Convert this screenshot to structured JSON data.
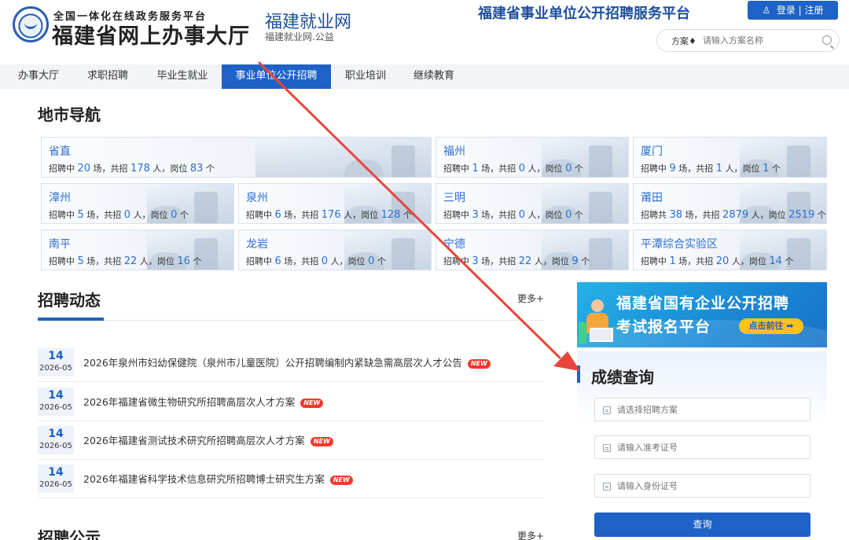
{
  "header": {
    "logo_line1": "全国一体化在线政务服务平台",
    "logo_line2": "福建省网上办事大厅",
    "site_name": "福建就业网",
    "site_sub": "福建就业网.公益",
    "platform_title": "福建省事业单位公开招聘服务平台",
    "login_label": "登录 | 注册",
    "search_type": "方案",
    "search_placeholder": "请输入方案名称"
  },
  "nav": {
    "items": [
      {
        "label": "办事大厅"
      },
      {
        "label": "求职招聘"
      },
      {
        "label": "毕业生就业"
      },
      {
        "label": "事业单位公开招聘",
        "active": true
      },
      {
        "label": "职业培训"
      },
      {
        "label": "继续教育"
      }
    ]
  },
  "city_nav": {
    "title": "地市导航",
    "labels": {
      "people_unit": "人，",
      "post_prefix": "岗位",
      "post_unit": "个"
    },
    "cities": [
      {
        "name": "省直",
        "prefix": "招聘中",
        "sessions": "20",
        "total": "178",
        "posts": "83"
      },
      {
        "name": "福州",
        "prefix": "招聘中",
        "sessions": "1",
        "total": "0",
        "posts": "0"
      },
      {
        "name": "厦门",
        "prefix": "招聘中",
        "sessions": "9",
        "total": "1",
        "posts": "1"
      },
      {
        "name": "漳州",
        "prefix": "招聘中",
        "sessions": "5",
        "total": "0",
        "posts": "0"
      },
      {
        "name": "泉州",
        "prefix": "招聘中",
        "sessions": "6",
        "total": "176",
        "posts": "128"
      },
      {
        "name": "三明",
        "prefix": "招聘中",
        "sessions": "3",
        "total": "0",
        "posts": "0"
      },
      {
        "name": "莆田",
        "prefix": "招聘共",
        "sessions": "38",
        "total": "2879",
        "posts": "2519"
      },
      {
        "name": "南平",
        "prefix": "招聘中",
        "sessions": "5",
        "total": "22",
        "posts": "16"
      },
      {
        "name": "龙岩",
        "prefix": "招聘中",
        "sessions": "6",
        "total": "0",
        "posts": "0"
      },
      {
        "name": "宁德",
        "prefix": "招聘中",
        "sessions": "3",
        "total": "22",
        "posts": "9"
      },
      {
        "name": "平潭综合实验区",
        "prefix": "招聘中",
        "sessions": "1",
        "total": "20",
        "posts": "14"
      }
    ]
  },
  "recruit_news": {
    "title": "招聘动态",
    "more": "更多+",
    "new_label": "NEW",
    "items": [
      {
        "day": "14",
        "ym": "2026-05",
        "title": "2026年泉州市妇幼保健院（泉州市儿童医院）公开招聘编制内紧缺急需高层次人才公告"
      },
      {
        "day": "14",
        "ym": "2026-05",
        "title": "2026年福建省微生物研究所招聘高层次人才方案"
      },
      {
        "day": "14",
        "ym": "2026-05",
        "title": "2026年福建省测试技术研究所招聘高层次人才方案"
      },
      {
        "day": "14",
        "ym": "2026-05",
        "title": "2026年福建省科学技术信息研究所招聘博士研究生方案"
      }
    ]
  },
  "recruit_notice": {
    "title": "招聘公示",
    "more": "更多+"
  },
  "banner": {
    "line1": "福建省国有企业公开招聘",
    "line2": "考试报名平台",
    "button": "点击前往 ➡"
  },
  "score_query": {
    "title": "成绩查询",
    "plan_placeholder": "请选择招聘方案",
    "ticket_placeholder": "请输入准考证号",
    "id_placeholder": "请输入身份证号",
    "button": "查询"
  },
  "colors": {
    "primary": "#1d62c4",
    "link_blue": "#2a6fd4",
    "annotation_red": "#e8463c",
    "new_badge": "#ef3b2d"
  }
}
